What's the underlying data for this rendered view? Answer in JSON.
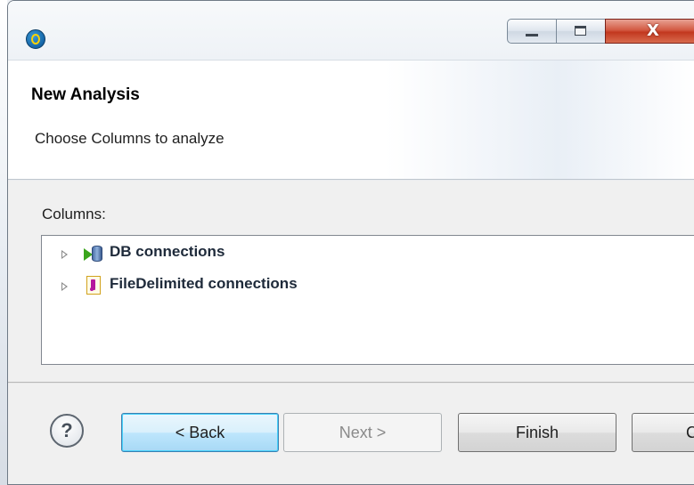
{
  "window": {
    "icon": "talend-logo-icon",
    "controls": {
      "minimize_icon": "minimize-icon",
      "maximize_icon": "maximize-icon",
      "close_glyph": "X"
    }
  },
  "header": {
    "title": "New Analysis",
    "subtitle": "Choose Columns to analyze"
  },
  "columns": {
    "label": "Columns:",
    "tree": [
      {
        "label": "DB connections",
        "icon": "db-connection-icon"
      },
      {
        "label": "FileDelimited connections",
        "icon": "file-delimited-icon"
      }
    ]
  },
  "footer": {
    "help_glyph": "?",
    "back_label": "< Back",
    "next_label": "Next >",
    "finish_label": "Finish",
    "cancel_label": "C"
  }
}
